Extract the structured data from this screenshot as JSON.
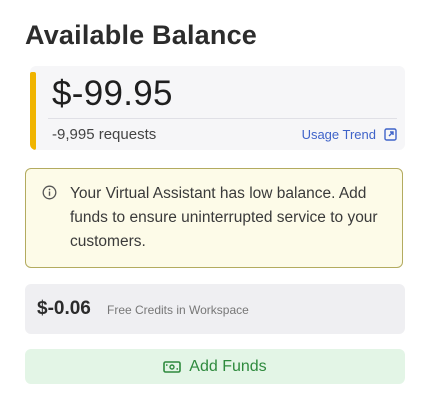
{
  "header": {
    "title": "Available Balance"
  },
  "balance": {
    "amount": "$-99.95",
    "requests": "-9,995 requests",
    "usage_trend_label": "Usage Trend",
    "accent_color": "#f0b400"
  },
  "alert": {
    "message": "Your Virtual Assistant has low balance. Add funds to ensure uninterrupted service to your customers.",
    "icon": "info-icon"
  },
  "credits": {
    "amount": "$-0.06",
    "label": "Free Credits in Workspace"
  },
  "add_funds": {
    "label": "Add Funds",
    "icon": "wallet-icon",
    "color": "#2e8a3d"
  }
}
